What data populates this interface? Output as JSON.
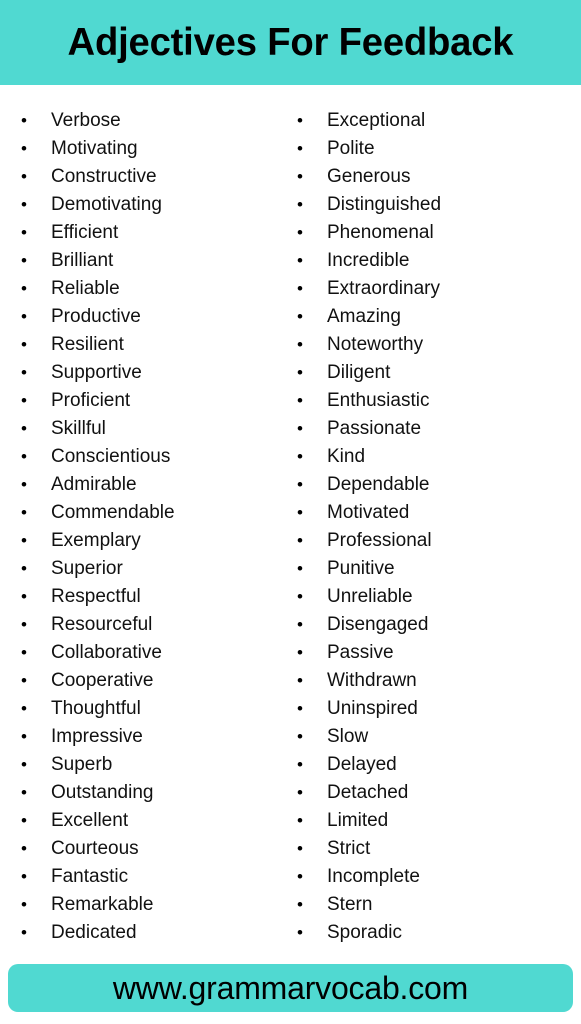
{
  "header": {
    "title": "Adjectives For Feedback",
    "background_color": "#50d9d1"
  },
  "theme": {
    "accent_color": "#50d9d1",
    "text_color": "#111111",
    "page_background": "#ffffff"
  },
  "list": {
    "bullet_glyph": "•",
    "left_column": [
      "Verbose",
      "Motivating",
      "Constructive",
      "Demotivating",
      "Efficient",
      "Brilliant",
      "Reliable",
      "Productive",
      "Resilient",
      "Supportive",
      "Proficient",
      "Skillful",
      "Conscientious",
      "Admirable",
      "Commendable",
      "Exemplary",
      "Superior",
      "Respectful",
      "Resourceful",
      "Collaborative",
      "Cooperative",
      "Thoughtful",
      "Impressive",
      "Superb",
      "Outstanding",
      "Excellent",
      "Courteous",
      "Fantastic",
      "Remarkable",
      "Dedicated"
    ],
    "right_column": [
      "Exceptional",
      "Polite",
      "Generous",
      "Distinguished",
      "Phenomenal",
      "Incredible",
      "Extraordinary",
      "Amazing",
      "Noteworthy",
      "Diligent",
      "Enthusiastic",
      "Passionate",
      "Kind",
      "Dependable",
      "Motivated",
      "Professional",
      "Punitive",
      "Unreliable",
      "Disengaged",
      "Passive",
      "Withdrawn",
      "Uninspired",
      "Slow",
      "Delayed",
      "Detached",
      "Limited",
      "Strict",
      "Incomplete",
      "Stern",
      "Sporadic"
    ]
  },
  "footer": {
    "url": "www.grammarvocab.com",
    "background_color": "#50d9d1"
  }
}
